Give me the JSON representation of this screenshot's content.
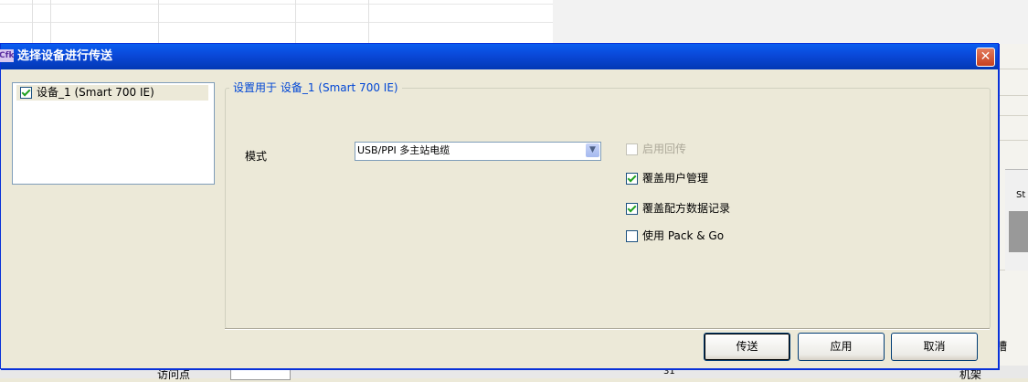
{
  "dialog": {
    "title": "选择设备进行传送",
    "icon_text": "Cfk",
    "close_label": "✕"
  },
  "tree": {
    "items": [
      {
        "label": "设备_1 (Smart 700 IE)",
        "checked": true
      }
    ]
  },
  "settings": {
    "group_title": "设置用于 设备_1 (Smart 700 IE)",
    "mode_label": "模式",
    "mode_value": "USB/PPI 多主站电缆",
    "options": [
      {
        "label": "启用回传",
        "checked": false,
        "enabled": false
      },
      {
        "label": "覆盖用户管理",
        "checked": true,
        "enabled": true
      },
      {
        "label": "覆盖配方数据记录",
        "checked": true,
        "enabled": true
      },
      {
        "label": "使用 Pack & Go",
        "checked": false,
        "enabled": true
      }
    ]
  },
  "buttons": {
    "transfer": "传送",
    "apply": "应用",
    "cancel": "取消"
  },
  "background": {
    "side_text": "St",
    "bottom_label": "访问点",
    "bottom_number": "31",
    "right_char_1": "槽",
    "right_char_2": "机架"
  }
}
